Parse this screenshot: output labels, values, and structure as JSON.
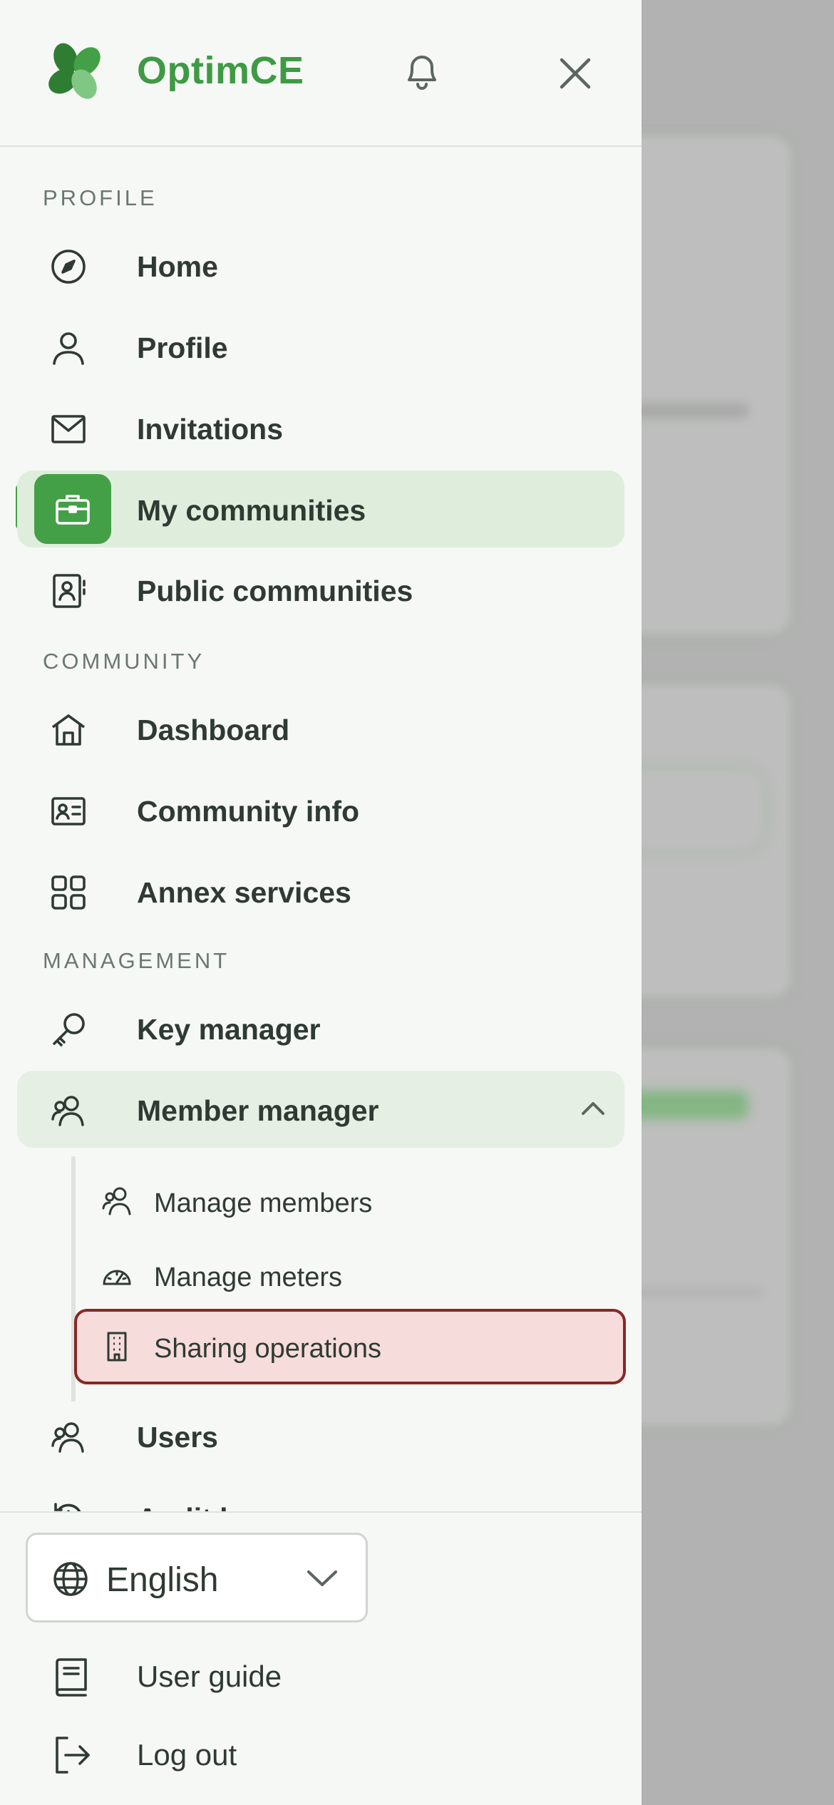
{
  "app": {
    "brand": "OptimCE"
  },
  "sections": {
    "profile": "PROFILE",
    "community": "COMMUNITY",
    "management": "MANAGEMENT"
  },
  "nav": {
    "home": "Home",
    "profile": "Profile",
    "invitations": "Invitations",
    "my_communities": "My communities",
    "public_communities": "Public communities",
    "dashboard": "Dashboard",
    "community_info": "Community info",
    "annex_services": "Annex services",
    "key_manager": "Key manager",
    "member_manager": "Member manager",
    "users": "Users",
    "audit_log_partial": "Audit l..."
  },
  "member_manager_sub": {
    "manage_members": "Manage members",
    "manage_meters": "Manage meters",
    "sharing_operations": "Sharing operations"
  },
  "footer": {
    "language": "English",
    "user_guide": "User guide",
    "log_out": "Log out"
  },
  "colors": {
    "accent": "#43a047",
    "brand_text": "#3e9a44",
    "active_bg": "#dfeddd",
    "highlight_bg": "#f7dcdc",
    "highlight_border": "#8b2626"
  }
}
